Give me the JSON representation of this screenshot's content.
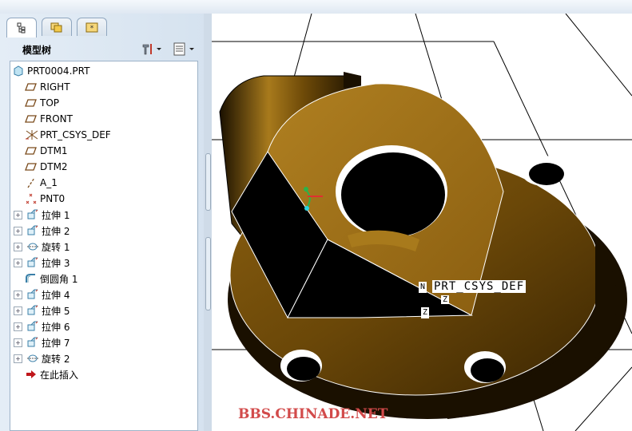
{
  "panel": {
    "title": "模型树",
    "tabs": [
      "model-tree-tab",
      "folder-browser-tab",
      "favorites-tab"
    ]
  },
  "tree": {
    "items": [
      {
        "label": "PRT0004.PRT",
        "icon": "part-icon",
        "expandable": false
      },
      {
        "label": "RIGHT",
        "icon": "datum-plane-icon",
        "expandable": false
      },
      {
        "label": "TOP",
        "icon": "datum-plane-icon",
        "expandable": false
      },
      {
        "label": "FRONT",
        "icon": "datum-plane-icon",
        "expandable": false
      },
      {
        "label": "PRT_CSYS_DEF",
        "icon": "coordinate-system-icon",
        "expandable": false
      },
      {
        "label": "DTM1",
        "icon": "datum-plane-icon",
        "expandable": false
      },
      {
        "label": "DTM2",
        "icon": "datum-plane-icon",
        "expandable": false
      },
      {
        "label": "A_1",
        "icon": "datum-axis-icon",
        "expandable": false
      },
      {
        "label": "PNT0",
        "icon": "datum-point-icon",
        "expandable": false
      },
      {
        "label": "拉伸 1",
        "icon": "extrude-icon",
        "expandable": true
      },
      {
        "label": "拉伸 2",
        "icon": "extrude-icon",
        "expandable": true
      },
      {
        "label": "旋转 1",
        "icon": "revolve-icon",
        "expandable": true
      },
      {
        "label": "拉伸 3",
        "icon": "extrude-icon",
        "expandable": true
      },
      {
        "label": "倒圆角 1",
        "icon": "round-icon",
        "expandable": false
      },
      {
        "label": "拉伸 4",
        "icon": "extrude-icon",
        "expandable": true
      },
      {
        "label": "拉伸 5",
        "icon": "extrude-icon",
        "expandable": true
      },
      {
        "label": "拉伸 6",
        "icon": "extrude-icon",
        "expandable": true
      },
      {
        "label": "拉伸 7",
        "icon": "extrude-icon",
        "expandable": true
      },
      {
        "label": "旋转 2",
        "icon": "revolve-icon",
        "expandable": true
      },
      {
        "label": "在此插入",
        "icon": "insert-here-arrow-icon",
        "expandable": false
      }
    ]
  },
  "viewport": {
    "csys_label": "PRT_CSYS_DEF",
    "csys_tag_n": "N",
    "csys_tag_z1": "Z",
    "csys_tag_z2": "Z",
    "watermark": "BBS.CHINADE.NET"
  },
  "colors": {
    "part_face_light": "#a87a1c",
    "part_face_mid": "#6e4a08",
    "part_face_dark": "#1a1000",
    "accent_red": "#d24a4a"
  }
}
